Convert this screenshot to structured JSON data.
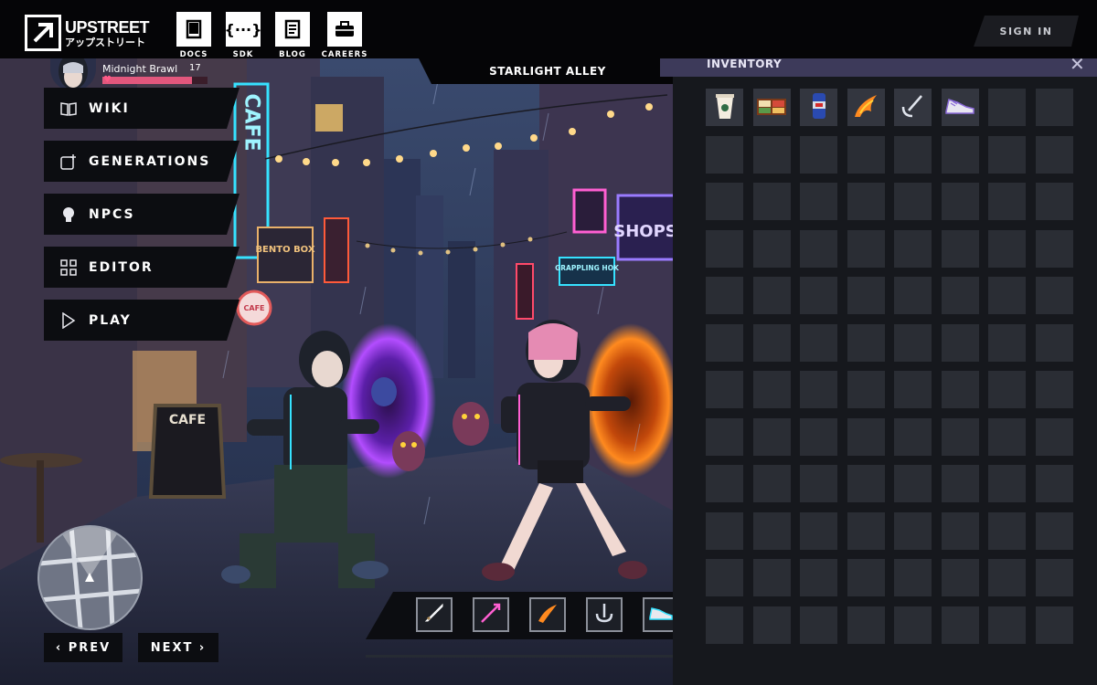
{
  "header": {
    "logo_en": "UPSTREET",
    "logo_jp": "アップストリート",
    "nav": [
      {
        "label": "DOCS",
        "icon": "book-icon"
      },
      {
        "label": "SDK",
        "icon": "code-braces-icon"
      },
      {
        "label": "BLOG",
        "icon": "document-icon"
      },
      {
        "label": "CAREERS",
        "icon": "briefcase-icon"
      }
    ],
    "sign_in": "SIGN IN"
  },
  "location": "STARLIGHT ALLEY",
  "player": {
    "name": "Midnight Brawl",
    "level": "17",
    "health_fraction": 0.85
  },
  "menu": [
    {
      "label": "WIKI",
      "icon": "open-book-icon"
    },
    {
      "label": "GENERATIONS",
      "icon": "image-plus-icon"
    },
    {
      "label": "NPCS",
      "icon": "person-head-icon"
    },
    {
      "label": "EDITOR",
      "icon": "grid-icon"
    },
    {
      "label": "PLAY",
      "icon": "play-icon"
    }
  ],
  "pager": {
    "prev": "‹ PREV",
    "next": "NEXT ›"
  },
  "hotbar": [
    "sword-icon",
    "magic-arrow-icon",
    "fire-slash-icon",
    "grappling-hook-icon",
    "sneaker-icon"
  ],
  "scene_signs": {
    "cafe_vertical": "CAFE",
    "bento": "BENTO BOX",
    "shops": "SHOPS",
    "grappling": "GRAPPLING HOK",
    "cafe_round": "CAFE",
    "cafe_board": "CAFE"
  },
  "inventory": {
    "title": "INVENTORY",
    "close": "✕",
    "columns": 8,
    "rows": 12,
    "items": [
      "coffee-cup-icon",
      "bento-box-icon",
      "energy-drink-icon",
      "fire-claw-icon",
      "grappling-hook-icon",
      "sneaker-icon"
    ]
  },
  "colors": {
    "accent": "#e2577d",
    "inventory_header": "#3d3a5a",
    "neon_cyan": "#36e2ff",
    "neon_pink": "#ff5fd2",
    "portal_purple": "#b34dff",
    "portal_orange": "#ff8a1f"
  }
}
